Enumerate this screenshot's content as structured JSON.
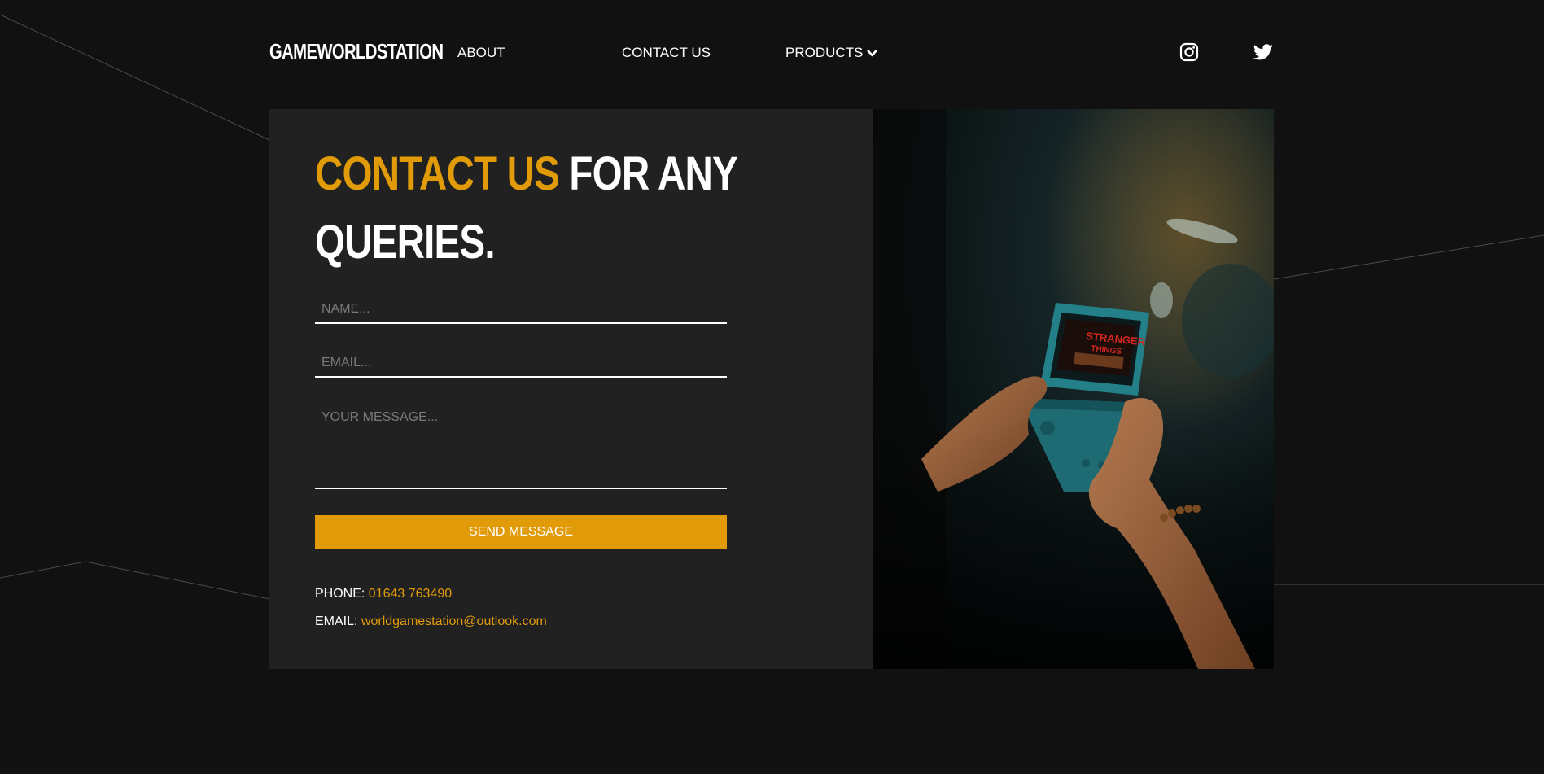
{
  "header": {
    "logo": "GAMEWORLDSTATION",
    "nav": {
      "about": "ABOUT",
      "contact": "CONTACT US",
      "products": "PRODUCTS"
    },
    "social": [
      {
        "icon": "instagram-icon"
      },
      {
        "icon": "twitter-icon"
      }
    ]
  },
  "contact": {
    "heading_highlight": "CONTACT US",
    "heading_rest": " FOR ANY",
    "heading_line2": "QUERIES.",
    "form": {
      "name_placeholder": "NAME...",
      "email_placeholder": "EMAIL...",
      "message_placeholder": "YOUR MESSAGE...",
      "submit_label": "SEND MESSAGE"
    },
    "phone_label": "PHONE: ",
    "phone_value": "01643 763490",
    "email_label": "EMAIL: ",
    "email_value": "worldgamestation@outlook.com"
  },
  "colors": {
    "accent": "#e19b09",
    "background": "#111111",
    "card": "#212121",
    "text": "#ffffff"
  }
}
